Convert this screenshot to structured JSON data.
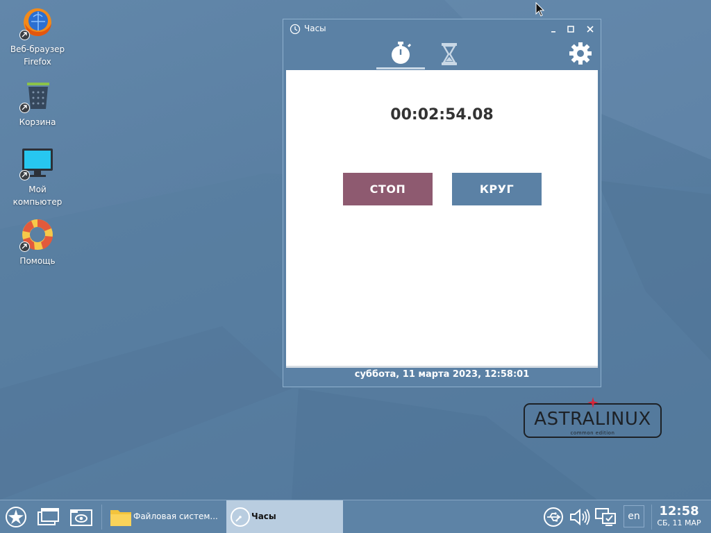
{
  "desktop": {
    "icons": [
      {
        "label": "Веб-браузер Firefox",
        "icon": "firefox-icon"
      },
      {
        "label": "Корзина",
        "icon": "trash-icon"
      },
      {
        "label": "Мой компьютер",
        "icon": "computer-icon"
      },
      {
        "label": "Помощь",
        "icon": "help-lifebuoy-icon"
      }
    ]
  },
  "window": {
    "title": "Часы",
    "tabs": [
      {
        "name": "stopwatch",
        "icon": "stopwatch-icon",
        "active": true
      },
      {
        "name": "timer",
        "icon": "hourglass-icon",
        "active": false
      }
    ],
    "settings_icon": "gear-icon",
    "elapsed": "00:02:54.08",
    "stop_label": "СТОП",
    "lap_label": "КРУГ",
    "footer_datetime": "суббота, 11 марта 2023, 12:58:01"
  },
  "logo": {
    "word": "ASTRALINUX",
    "sub": "common edition"
  },
  "taskbar": {
    "tasks": [
      {
        "label": "Файловая систем...",
        "icon": "folder-icon",
        "active": false
      },
      {
        "label": "Часы",
        "icon": "clock-icon",
        "active": true
      }
    ],
    "lang": "en",
    "time": "12:58",
    "date": "СБ, 11 МАР"
  },
  "colors": {
    "desktop": "#5b80a3",
    "stop_button": "#8e5a70",
    "lap_button": "#5b81a5",
    "active_task": "#b9cde0"
  }
}
